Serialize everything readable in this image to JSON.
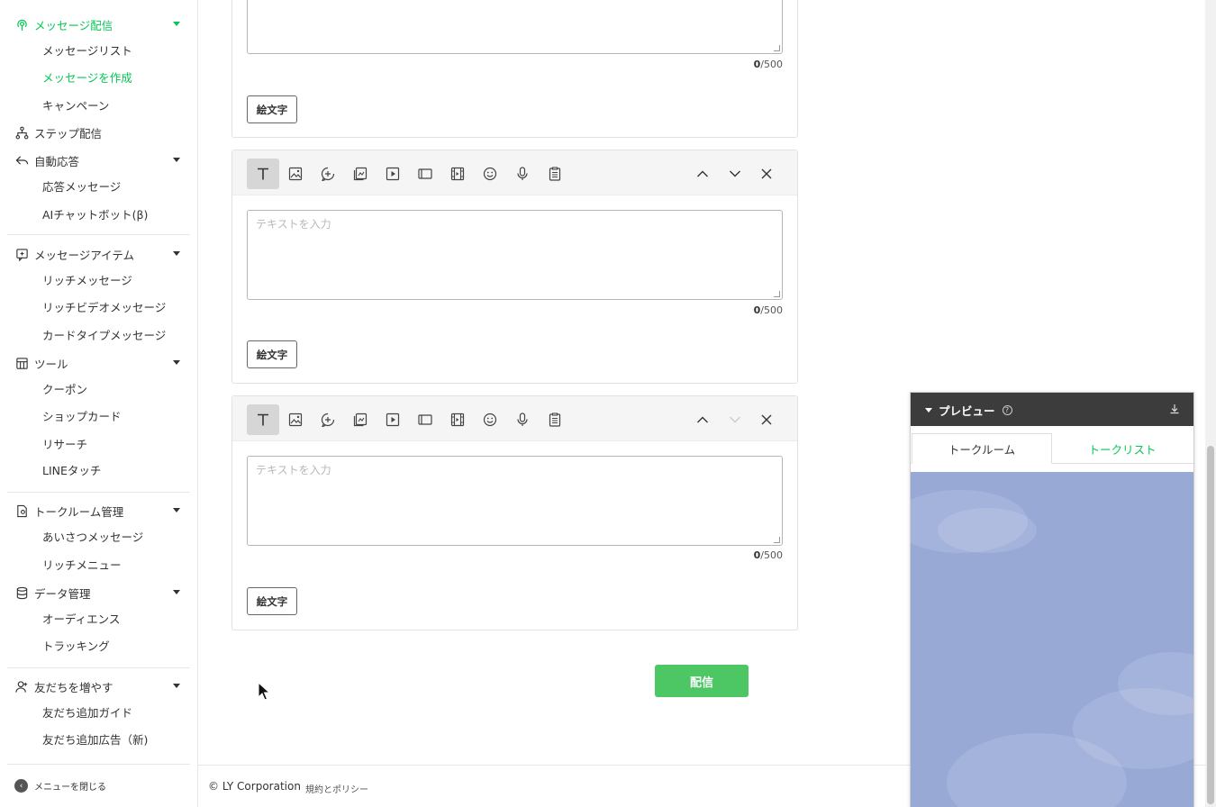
{
  "sidebar": {
    "sections": [
      {
        "label": "メッセージ配信",
        "icon": "broadcast-icon",
        "active": true,
        "sub": [
          {
            "label": "メッセージリスト",
            "active": false
          },
          {
            "label": "メッセージを作成",
            "active": true
          },
          {
            "label": "キャンペーン",
            "active": false
          }
        ]
      },
      {
        "label": "ステップ配信",
        "icon": "step-icon",
        "sub": []
      },
      {
        "label": "自動応答",
        "icon": "reply-icon",
        "sub": [
          {
            "label": "応答メッセージ"
          },
          {
            "label": "AIチャットボット(β)"
          }
        ]
      },
      {
        "label": "メッセージアイテム",
        "icon": "message-item-icon",
        "sub": [
          {
            "label": "リッチメッセージ"
          },
          {
            "label": "リッチビデオメッセージ"
          },
          {
            "label": "カードタイプメッセージ"
          }
        ]
      },
      {
        "label": "ツール",
        "icon": "tool-icon",
        "sub": [
          {
            "label": "クーポン"
          },
          {
            "label": "ショップカード"
          },
          {
            "label": "リサーチ"
          },
          {
            "label": "LINEタッチ"
          }
        ]
      },
      {
        "label": "トークルーム管理",
        "icon": "talkroom-icon",
        "sub": [
          {
            "label": "あいさつメッセージ"
          },
          {
            "label": "リッチメニュー"
          }
        ]
      },
      {
        "label": "データ管理",
        "icon": "database-icon",
        "sub": [
          {
            "label": "オーディエンス"
          },
          {
            "label": "トラッキング"
          }
        ]
      },
      {
        "label": "友だちを増やす",
        "icon": "add-friend-icon",
        "sub": [
          {
            "label": "友だち追加ガイド"
          },
          {
            "label": "友だち追加広告（新)"
          }
        ]
      }
    ],
    "close_menu": "メニューを閉じる"
  },
  "editor": {
    "placeholder": "テキストを入力",
    "counter_value": "0",
    "counter_max": "/500",
    "emoji_label": "絵文字",
    "tools": [
      "text-icon",
      "image-icon",
      "stamp-icon",
      "coupon-icon",
      "video-icon",
      "cardtype-icon",
      "richvideo-icon",
      "emoji-icon",
      "voice-icon",
      "research-icon"
    ]
  },
  "send_label": "配信",
  "footer": {
    "copyright": "© LY Corporation",
    "terms": "規約とポリシー"
  },
  "preview": {
    "title": "プレビュー",
    "help": "?",
    "tab_talkroom": "トークルーム",
    "tab_talklist": "トークリスト",
    "background_color": "#98a9d6"
  },
  "colors": {
    "accent": "#06c755",
    "send_button": "#4cc764"
  }
}
